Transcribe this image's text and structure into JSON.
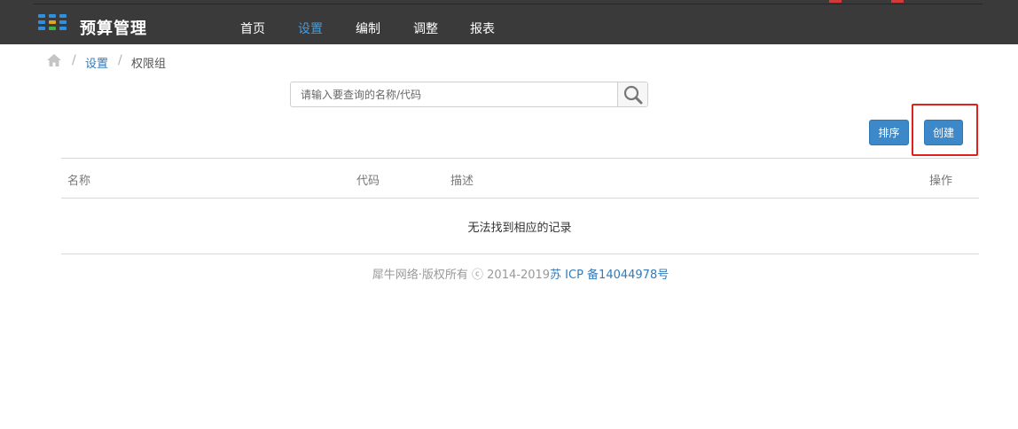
{
  "header": {
    "brand": "预算管理",
    "logo_icon": "grid-dots-icon",
    "colors": {
      "bar": "#3a3a3a",
      "active": "#3aa0e6"
    },
    "nav": [
      {
        "label": "首页",
        "active": false
      },
      {
        "label": "设置",
        "active": true
      },
      {
        "label": "编制",
        "active": false
      },
      {
        "label": "调整",
        "active": false
      },
      {
        "label": "报表",
        "active": false
      }
    ]
  },
  "breadcrumb": {
    "home_icon": "home-icon",
    "separator": "/",
    "items": [
      {
        "label": "设置",
        "link": true
      },
      {
        "label": "权限组",
        "link": false
      }
    ]
  },
  "search": {
    "placeholder": "请输入要查询的名称/代码",
    "value": "",
    "icon": "search-icon"
  },
  "toolbar": {
    "sort_label": "排序",
    "create_label": "创建",
    "button_color": "#3d88c9",
    "highlight_color": "#e0201c"
  },
  "table": {
    "columns": [
      "名称",
      "代码",
      "描述",
      "操作"
    ],
    "rows": [],
    "empty_text": "无法找到相应的记录"
  },
  "footer": {
    "copyright": "犀牛网络·版权所有 ⓒ 2014-2019",
    "icp": "苏 ICP 备14044978号"
  }
}
